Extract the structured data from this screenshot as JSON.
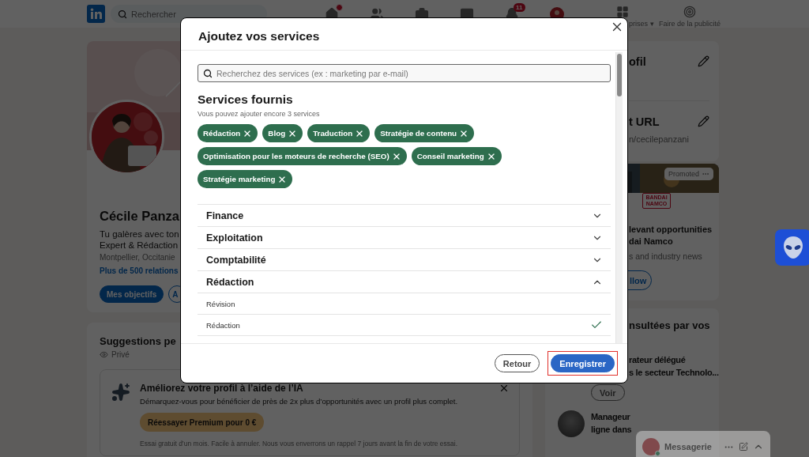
{
  "nav": {
    "search_placeholder": "Rechercher",
    "icons": [
      {
        "kind": "home",
        "dot": true
      },
      {
        "kind": "network",
        "dot": false
      },
      {
        "kind": "jobs",
        "dot": false
      },
      {
        "kind": "messaging",
        "dot": false
      },
      {
        "kind": "notifications",
        "dot": false,
        "badge": "11"
      },
      {
        "kind": "me",
        "dot": false
      }
    ],
    "menu_label": "prises",
    "menu_caret": "▾",
    "ad_label": "Faire de la publicité"
  },
  "profile": {
    "name": "Cécile Panza",
    "headline_lines": [
      "Tu galères avec ton",
      "Expert & Rédaction"
    ],
    "location": "Montpellier, Occitanie",
    "connections": "Plus de 500 relations",
    "buttons": [
      {
        "label": "Mes objectifs",
        "kind": "primary"
      },
      {
        "label": "A",
        "kind": "outline"
      }
    ]
  },
  "suggestions": {
    "title": "Suggestions pe",
    "visibility": "Privé",
    "card": {
      "title": "Améliorez votre profil à l’aide de l’IA",
      "text": "Démarquez-vous pour bénéficier de près de 2x plus d’opportunités avec un profil plus complet.",
      "button": "Réessayer Premium pour 0 €",
      "note": "Essai gratuit d’un mois. Facile à annuler. Nous vous enverrons un rappel 7 jours avant la fin de votre essai."
    }
  },
  "sidebar": {
    "profile_items": [
      {
        "title": "ofil"
      },
      {
        "title": "t URL",
        "subtitle": "n/cecilepanzani"
      }
    ],
    "ad": {
      "badge": "Promoted",
      "logo_lines": [
        "BANDAI",
        "NAMCO"
      ],
      "title_lines": [
        "levant opportunities",
        "dai Namco"
      ],
      "subtitle": "s and industry news",
      "button": "llow"
    },
    "pages": {
      "title": "nsultées par vos",
      "people": [
        {
          "lines": [
            "rateur délégué",
            "s le secteur Technolo..."
          ],
          "button": "Voir"
        },
        {
          "lines": [
            "Manageur",
            "ligne dans"
          ]
        }
      ]
    }
  },
  "messaging": {
    "title": "Messagerie"
  },
  "modal": {
    "title": "Ajoutez vos services",
    "search_placeholder": "Recherchez des services (ex : marketing par e-mail)",
    "section_title": "Services fournis",
    "hint": "Vous pouvez ajouter encore 3 services",
    "chips": [
      "Rédaction",
      "Blog",
      "Traduction",
      "Stratégie de contenu",
      "Optimisation pour les moteurs de recherche (SEO)",
      "Conseil marketing",
      "Stratégie marketing"
    ],
    "categories": [
      {
        "label": "Finance",
        "expanded": false
      },
      {
        "label": "Exploitation",
        "expanded": false
      },
      {
        "label": "Comptabilité",
        "expanded": false
      },
      {
        "label": "Rédaction",
        "expanded": true,
        "children": [
          {
            "label": "Révision",
            "selected": false
          },
          {
            "label": "Rédaction",
            "selected": true
          }
        ]
      }
    ],
    "buttons": [
      {
        "label": "Retour",
        "kind": "secondary",
        "highlighted": false
      },
      {
        "label": "Enregistrer",
        "kind": "primary",
        "highlighted": true
      }
    ]
  }
}
